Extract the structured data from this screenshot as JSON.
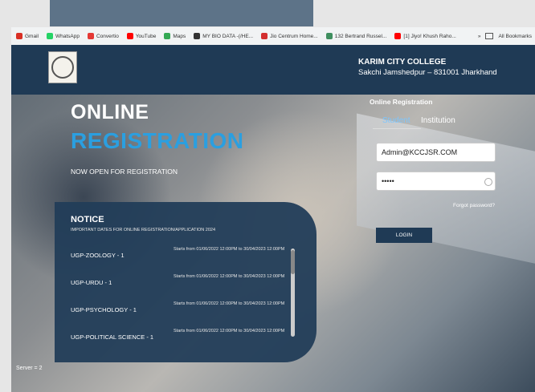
{
  "bookmarks": [
    "Gmail",
    "WhatsApp",
    "Convertio",
    "YouTube",
    "Maps",
    "MY BIO DATA -(/HE...",
    "Jio Centrum Home...",
    "132 Bertrand Russel...",
    "[1] Jiyo! Khush Raho..."
  ],
  "bookmarks_right": [
    "»",
    "All Bookmarks"
  ],
  "college": {
    "name": "KARIM CITY COLLEGE",
    "address": "Sakchi Jamshedpur – 831001 Jharkhand"
  },
  "hero": {
    "line1": "ONLINE",
    "line2": "REGISTRATION",
    "subtitle": "NOW OPEN FOR REGISTRATION"
  },
  "login": {
    "title": "Online Registration",
    "tabs": [
      "Student",
      "Institution"
    ],
    "username": "Admin@KCCJSR.COM",
    "password": "•••••",
    "forgot": "Forgot password?",
    "button": "LOGIN"
  },
  "notice": {
    "heading": "NOTICE",
    "subheading": "IMPORTANT DATES FOR ONLINE REGISTRATION/APPLICATION 2024",
    "rows": [
      {
        "course": "UGP-ZOOLOGY - 1",
        "dates": "Starts from 01/06/2022 12:00PM to 30/04/2023 12:00PM"
      },
      {
        "course": "UGP-URDU - 1",
        "dates": "Starts from 01/06/2022 12:00PM to 30/04/2023 12:00PM"
      },
      {
        "course": "UGP-PSYCHOLOGY - 1",
        "dates": "Starts from 01/06/2022 12:00PM to 30/04/2023 12:00PM"
      },
      {
        "course": "UGP-POLITICAL SCIENCE - 1",
        "dates": "Starts from 01/06/2022 12:00PM to 30/04/2023 12:00PM"
      }
    ]
  },
  "footer": {
    "server": "Server = 2"
  }
}
